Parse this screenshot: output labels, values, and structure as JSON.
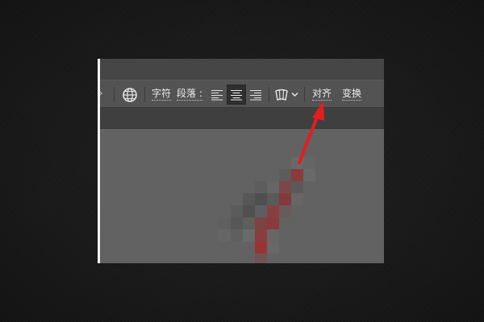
{
  "toolbar": {
    "character_label": "字符",
    "paragraph_label": "段落 :",
    "align_label": "对齐",
    "transform_label": "变换",
    "text_align": [
      "left",
      "center",
      "right"
    ],
    "active_text_align": "center"
  },
  "icons": {
    "collapse": "chevron-left-icon",
    "globe": "globe-icon",
    "warp": "warp-text-icon",
    "dropdown": "chevron-down-icon"
  },
  "colors": {
    "annotation_arrow": "#e21e1e",
    "highlight_pixels": "#8a3a3a"
  }
}
